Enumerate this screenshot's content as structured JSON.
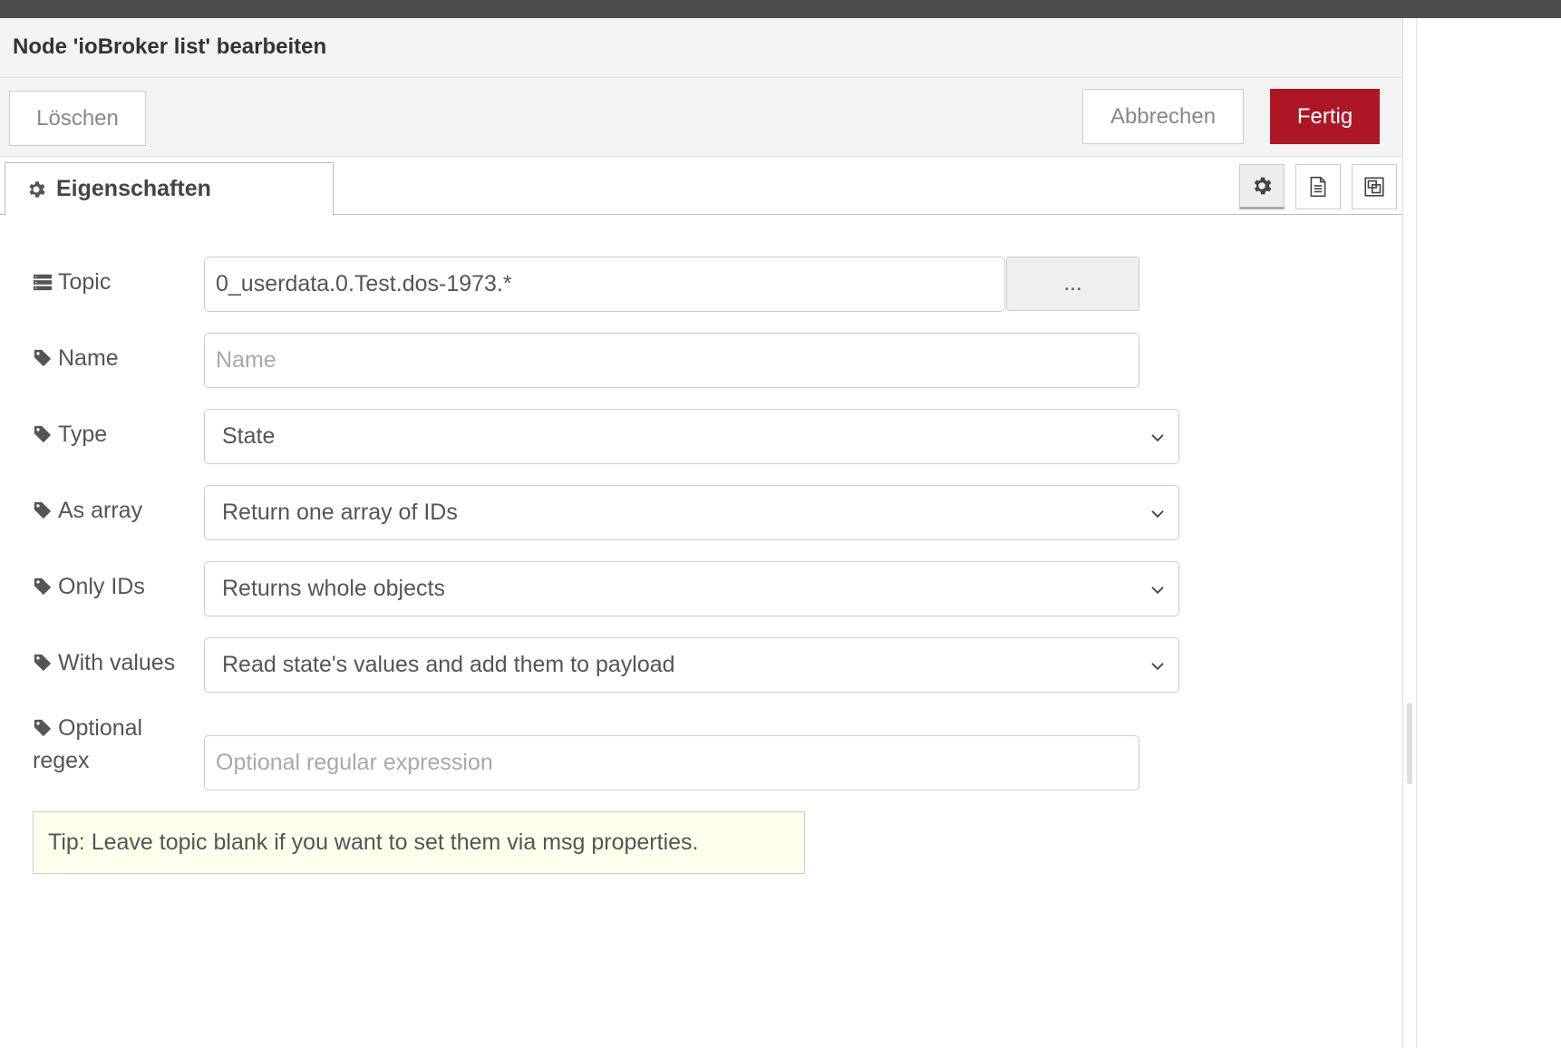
{
  "dialog": {
    "title": "Node 'ioBroker list' bearbeiten",
    "buttons": {
      "delete": "Löschen",
      "cancel": "Abbrechen",
      "done": "Fertig"
    },
    "accent_color": "#ad1625"
  },
  "tabs": {
    "properties": {
      "label": "Eigenschaften",
      "icon": "gear-icon"
    },
    "tool_icons": [
      "gear-icon",
      "document-icon",
      "frame-icon"
    ]
  },
  "form": {
    "topic": {
      "label": "Topic",
      "icon": "list-icon",
      "value": "0_userdata.0.Test.dos-1973.*",
      "browse_label": "..."
    },
    "name": {
      "label": "Name",
      "icon": "tag-icon",
      "placeholder": "Name"
    },
    "type": {
      "label": "Type",
      "icon": "tag-icon",
      "value": "State"
    },
    "as_array": {
      "label": "As array",
      "icon": "tag-icon",
      "value": "Return one array of IDs"
    },
    "only_ids": {
      "label": "Only IDs",
      "icon": "tag-icon",
      "value": "Returns whole objects"
    },
    "with_values": {
      "label": "With values",
      "icon": "tag-icon",
      "value": "Read state's values and add them to payload"
    },
    "regex": {
      "label_line1": "Optional",
      "label_line2": "regex",
      "icon": "tag-icon",
      "placeholder": "Optional regular expression"
    }
  },
  "tip": "Tip: Leave topic blank if you want to set them via msg properties."
}
